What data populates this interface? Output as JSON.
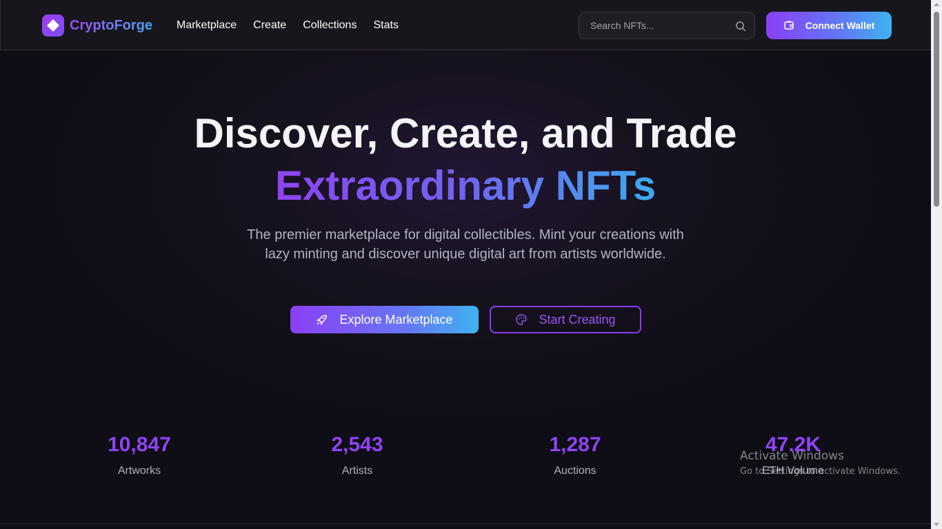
{
  "brand": {
    "name": "CryptoForge",
    "accent_start": "#9b3ff2",
    "accent_end": "#4aa6ef"
  },
  "nav": [
    {
      "label": "Marketplace"
    },
    {
      "label": "Create"
    },
    {
      "label": "Collections"
    },
    {
      "label": "Stats"
    }
  ],
  "search": {
    "placeholder": "Search NFTs...",
    "icon": "search-icon"
  },
  "wallet": {
    "label": "Connect Wallet",
    "icon": "wallet-icon"
  },
  "hero": {
    "title_line1": "Discover, Create, and Trade",
    "title_line2": "Extraordinary NFTs",
    "subtitle": "The premier marketplace for digital collectibles. Mint your creations with lazy minting and discover unique digital art from artists worldwide.",
    "primary_cta": {
      "label": "Explore Marketplace",
      "icon": "rocket-icon"
    },
    "secondary_cta": {
      "label": "Start Creating",
      "icon": "palette-icon"
    }
  },
  "stats": [
    {
      "value": "10,847",
      "label": "Artworks"
    },
    {
      "value": "2,543",
      "label": "Artists"
    },
    {
      "value": "1,287",
      "label": "Auctions"
    },
    {
      "value": "47.2K",
      "label": "ETH Volume"
    }
  ],
  "watermark": {
    "line1": "Activate Windows",
    "line2": "Go to Settings to activate Windows."
  }
}
